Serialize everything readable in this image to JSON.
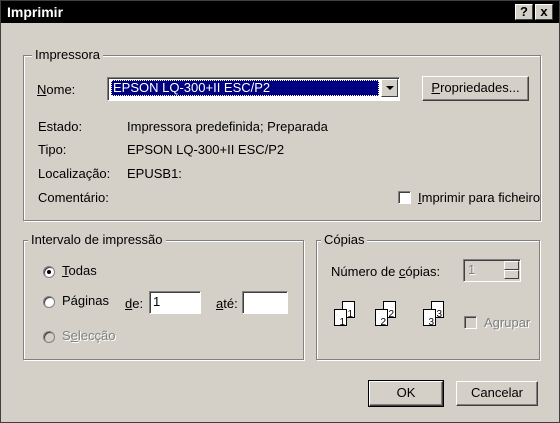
{
  "window": {
    "title": "Imprimir",
    "help_btn": "?",
    "close_btn": "x"
  },
  "printer": {
    "group_label": "Impressora",
    "name_label": "Nome:",
    "name_value": "EPSON LQ-300+II ESC/P2",
    "properties_btn": "Propriedades...",
    "status_label": "Estado:",
    "status_value": "Impressora predefinida; Preparada",
    "type_label": "Tipo:",
    "type_value": "EPSON LQ-300+II ESC/P2",
    "location_label": "Localização:",
    "location_value": "EPUSB1:",
    "comment_label": "Comentário:",
    "print_to_file": "Imprimir para ficheiro"
  },
  "range": {
    "group_label": "Intervalo de impressão",
    "all": "Todas",
    "pages": "Páginas",
    "from_label": "de:",
    "from_value": "1",
    "to_label": "até:",
    "to_value": "",
    "selection": "Selecção"
  },
  "copies": {
    "group_label": "Cópias",
    "count_label": "Número de cópias:",
    "count_value": "1",
    "collate": "Agrupar",
    "page_numbers": [
      "1",
      "1",
      "2",
      "2",
      "3",
      "3"
    ]
  },
  "buttons": {
    "ok": "OK",
    "cancel": "Cancelar"
  }
}
